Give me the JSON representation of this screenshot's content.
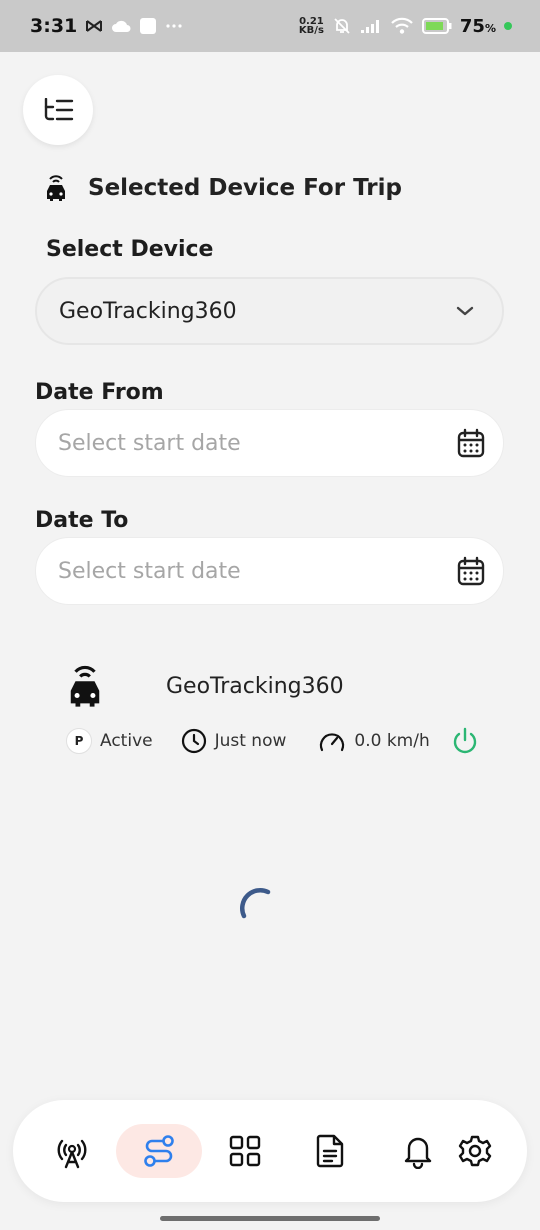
{
  "status_bar": {
    "time": "3:31",
    "net_speed_top": "0.21",
    "net_speed_unit": "KB/s",
    "battery_pct": "75",
    "battery_suffix": "%"
  },
  "header": {
    "title": "Selected Device For Trip"
  },
  "form": {
    "select_device_label": "Select Device",
    "selected_device": "GeoTracking360",
    "date_from_label": "Date From",
    "date_from_placeholder": "Select start date",
    "date_to_label": "Date To",
    "date_to_placeholder": "Select start date"
  },
  "device_card": {
    "name": "GeoTracking360",
    "parking_badge": "P",
    "status": "Active",
    "last_update": "Just now",
    "speed": "0.0 km/h"
  },
  "colors": {
    "accent_blue": "#2f80ed",
    "power_green": "#2bb673",
    "active_nav_bg": "#fde8e4",
    "spinner": "#3d5a8a"
  },
  "nav": {
    "items": [
      {
        "icon": "broadcast-tower-icon"
      },
      {
        "icon": "route-icon",
        "active": true
      },
      {
        "icon": "grid-icon"
      },
      {
        "icon": "document-icon"
      },
      {
        "icon": "bell-icon"
      },
      {
        "icon": "gear-icon"
      }
    ]
  }
}
